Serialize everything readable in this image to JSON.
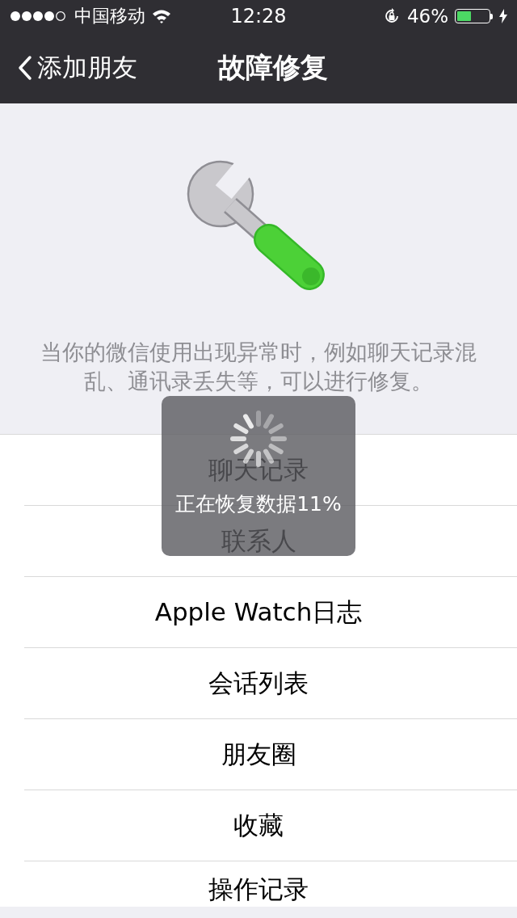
{
  "status_bar": {
    "carrier": "中国移动",
    "time": "12:28",
    "battery_text": "46%",
    "battery": {
      "level": 0.46,
      "charging": true
    }
  },
  "nav": {
    "back": "添加朋友",
    "title": "故障修复"
  },
  "description": "当你的微信使用出现异常时，例如聊天记录混乱、通讯录丢失等，可以进行修复。",
  "items": [
    {
      "label": "聊天记录"
    },
    {
      "label": "联系人"
    },
    {
      "label": "Apple Watch日志"
    },
    {
      "label": "会话列表"
    },
    {
      "label": "朋友圈"
    },
    {
      "label": "收藏"
    },
    {
      "label": "操作记录"
    }
  ],
  "hud": {
    "text": "正在恢复数据11%"
  }
}
